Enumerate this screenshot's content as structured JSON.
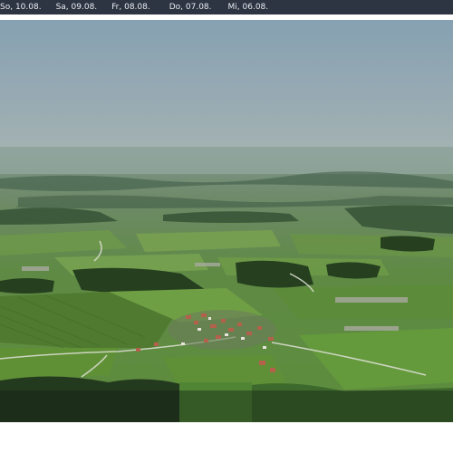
{
  "archive_bar": {
    "dates": [
      "So, 10.08.",
      "Sa, 09.08.",
      "Fr, 08.08.",
      "Do, 07.08.",
      "Mi, 06.08."
    ]
  },
  "webcam": {
    "image_icon": "landscape-photo-icon",
    "colors": {
      "sky_top": "#8aa0ae",
      "sky_haze": "#a7b4b5",
      "field_green": "#5b8a3a",
      "forest_dark": "#2e4a2a",
      "roof_red": "#b05a46",
      "overlay": "#1e2a1e"
    }
  }
}
